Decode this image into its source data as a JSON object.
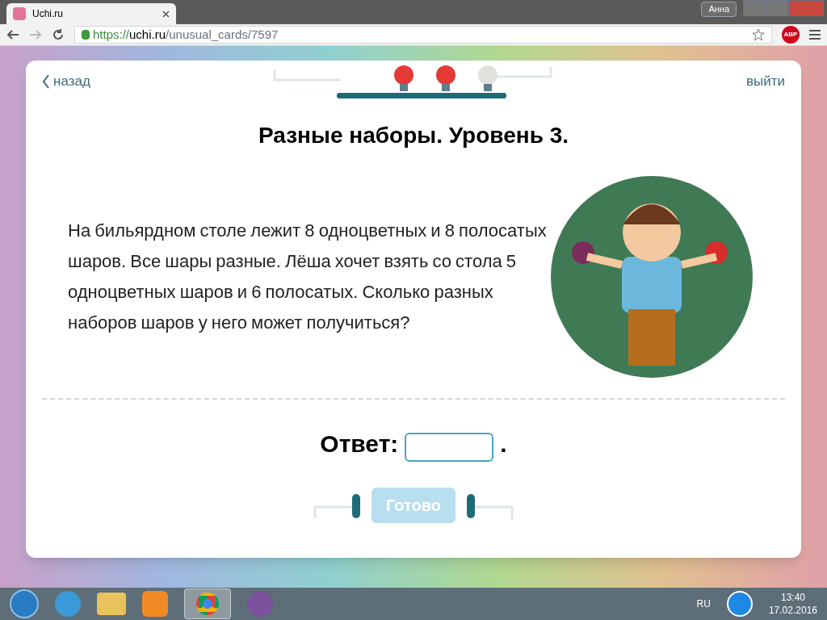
{
  "browser": {
    "tab_title": "Uchi.ru",
    "user": "Анна",
    "url_scheme": "https://",
    "url_host": "uchi.ru",
    "url_path": "/unusual_cards/7597",
    "adblock": "ABP"
  },
  "card": {
    "back": "назад",
    "exit": "выйти",
    "bulbs": [
      {
        "lit": true
      },
      {
        "lit": true
      },
      {
        "lit": false
      }
    ],
    "title": "Разные наборы. Уровень 3.",
    "question": "На бильярдном столе лежит 8 одноцветных и 8 полосатых шаров. Все шары разные. Лёша хочет взять со стола 5 одноцветных шаров и 6 полосатых. Сколько разных наборов шаров у него может получиться?",
    "answer_label": "Ответ:",
    "answer_suffix": ".",
    "submit": "Готово",
    "submit_disabled": true
  },
  "taskbar": {
    "language": "RU",
    "time": "13:40",
    "date": "17.02.2016"
  }
}
